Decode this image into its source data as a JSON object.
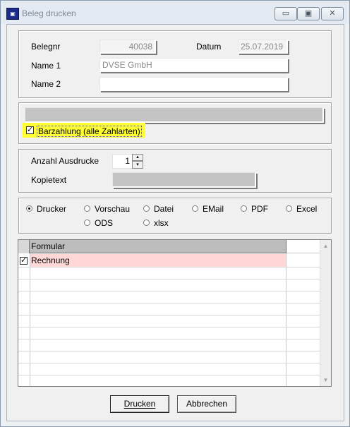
{
  "window": {
    "title": "Beleg drucken",
    "icon": "app-icon"
  },
  "caption_buttons": {
    "minimize": "▭",
    "maximize": "▣",
    "close": "✕"
  },
  "header": {
    "belegnr_label": "Belegnr",
    "belegnr_value": "40038",
    "datum_label": "Datum",
    "datum_value": "25.07.2019",
    "name1_label": "Name 1",
    "name1_value": "DVSE GmbH",
    "name2_label": "Name 2",
    "name2_value": ""
  },
  "payment": {
    "barzahlung_label": "Barzahlung (alle Zahlarten)",
    "barzahlung_checked": true,
    "highlight_color": "#ffff33"
  },
  "copies": {
    "anzahl_label": "Anzahl Ausdrucke",
    "anzahl_value": "1",
    "kopietext_label": "Kopietext",
    "kopietext_value": ""
  },
  "output": {
    "selected": "Drucker",
    "options": [
      "Drucker",
      "Vorschau",
      "Datei",
      "EMail",
      "PDF",
      "Excel",
      "ODS",
      "xlsx"
    ]
  },
  "grid": {
    "column_header": "Formular",
    "rows": [
      {
        "checked": true,
        "label": "Rechnung",
        "color": "#ffd7d7"
      }
    ]
  },
  "buttons": {
    "print_label": "Drucken",
    "cancel_label": "Abbrechen"
  }
}
